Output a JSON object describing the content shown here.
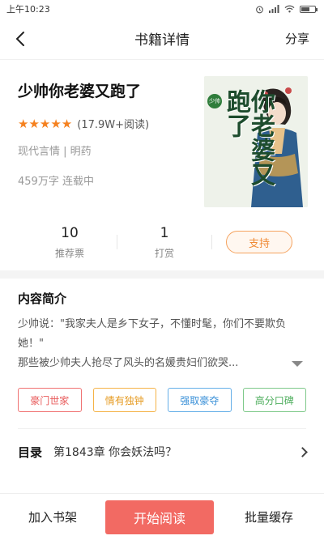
{
  "status_bar": {
    "time": "上午10:23"
  },
  "nav": {
    "title": "书籍详情",
    "share_label": "分享"
  },
  "book": {
    "title": "少帅你老婆又跑了",
    "stars": "★★★★★",
    "rating_text": "(17.9W+阅读)",
    "category": "现代言情 | 明药",
    "words_status": "459万字  连载中",
    "cover_title": "你老婆又跑了",
    "cover_prefix": "少帅"
  },
  "stats": {
    "recommend_count": "10",
    "recommend_label": "推荐票",
    "tip_count": "1",
    "tip_label": "打赏",
    "support_label": "支持"
  },
  "intro": {
    "heading": "内容简介",
    "line1": "少帅说：\"我家夫人是乡下女子，不懂时髦，你们不要欺负她！\"",
    "line2": "那些被少帅夫人抢尽了风头的名媛贵妇们欲哭..."
  },
  "tags": [
    "豪门世家",
    "情有独钟",
    "强取豪夺",
    "高分口碑"
  ],
  "toc": {
    "label": "目录",
    "chapter": "第1843章 你会妖法吗？"
  },
  "bottom": {
    "add_shelf": "加入书架",
    "start_read": "开始阅读",
    "batch_cache": "批量缓存"
  }
}
